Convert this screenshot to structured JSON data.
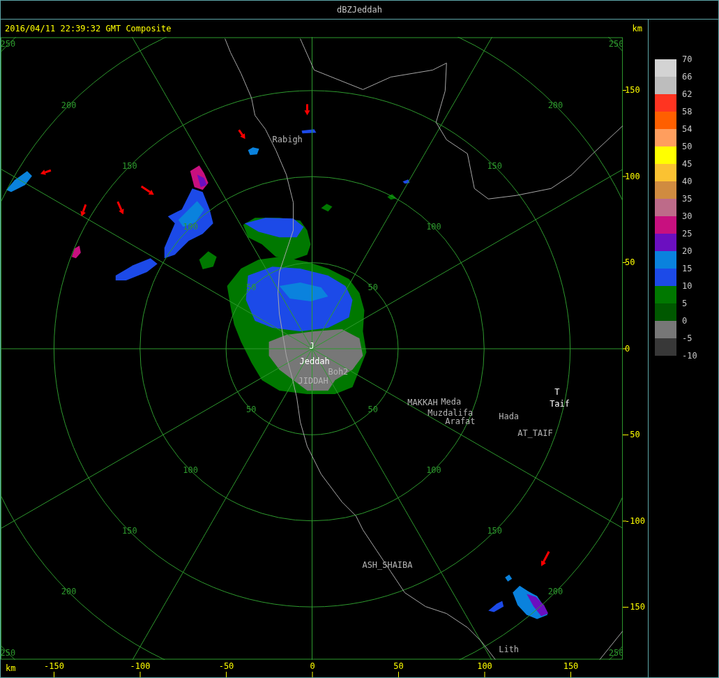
{
  "window": {
    "title": "dBZJeddah"
  },
  "header": {
    "timestamp": "2016/04/11 22:39:32 GMT Composite",
    "unit": "km"
  },
  "plot": {
    "rings": [
      {
        "labels": [
          "50",
          "50",
          "50",
          "50"
        ]
      },
      {
        "labels": [
          "100",
          "100",
          "100",
          "100"
        ]
      },
      {
        "labels": [
          "150",
          "150",
          "150",
          "150"
        ]
      },
      {
        "labels": [
          "200",
          "200",
          "200",
          "200"
        ]
      },
      {
        "labels": [
          "250",
          "250",
          "250",
          "250"
        ]
      }
    ],
    "places": [
      {
        "name": "Rabigh",
        "kind": "city"
      },
      {
        "name": "J",
        "kind": "radar"
      },
      {
        "name": "Jeddah",
        "kind": "radar"
      },
      {
        "name": "Boh2",
        "kind": "city"
      },
      {
        "name": "JIDDAH",
        "kind": "city"
      },
      {
        "name": "MAKKAH",
        "kind": "city"
      },
      {
        "name": "Meda",
        "kind": "city"
      },
      {
        "name": "Muzdalifa",
        "kind": "city"
      },
      {
        "name": "Arafat",
        "kind": "city"
      },
      {
        "name": "Hada",
        "kind": "city"
      },
      {
        "name": "AT_TAIF",
        "kind": "city"
      },
      {
        "name": "T",
        "kind": "radar"
      },
      {
        "name": "Taif",
        "kind": "radar"
      },
      {
        "name": "ASH_SHAIBA",
        "kind": "city"
      },
      {
        "name": "Lith",
        "kind": "city"
      }
    ]
  },
  "y_axis": {
    "ticks": [
      "150",
      "100",
      "50",
      "0",
      "-50",
      "-100",
      "-150"
    ]
  },
  "x_axis": {
    "unit": "km",
    "ticks": [
      "-150",
      "-100",
      "-50",
      "0",
      "50",
      "100",
      "150"
    ]
  },
  "legend": {
    "swatches": [
      {
        "color": "#d3d3d3"
      },
      {
        "color": "#bdbdbd"
      },
      {
        "color": "#ff3421"
      },
      {
        "color": "#ff5f00"
      },
      {
        "color": "#ff9e5e"
      },
      {
        "color": "#ffff00"
      },
      {
        "color": "#fbc232"
      },
      {
        "color": "#d08b40"
      },
      {
        "color": "#bd6b89"
      },
      {
        "color": "#c8107f"
      },
      {
        "color": "#6b0fc0"
      },
      {
        "color": "#0a82dd"
      },
      {
        "color": "#1c4ae8"
      },
      {
        "color": "#007800"
      },
      {
        "color": "#005800"
      },
      {
        "color": "#777777"
      },
      {
        "color": "#383838"
      }
    ],
    "labels": [
      "70",
      "66",
      "62",
      "58",
      "54",
      "50",
      "45",
      "40",
      "35",
      "30",
      "25",
      "20",
      "15",
      "10",
      "5",
      "0",
      "-5",
      "-10"
    ]
  }
}
